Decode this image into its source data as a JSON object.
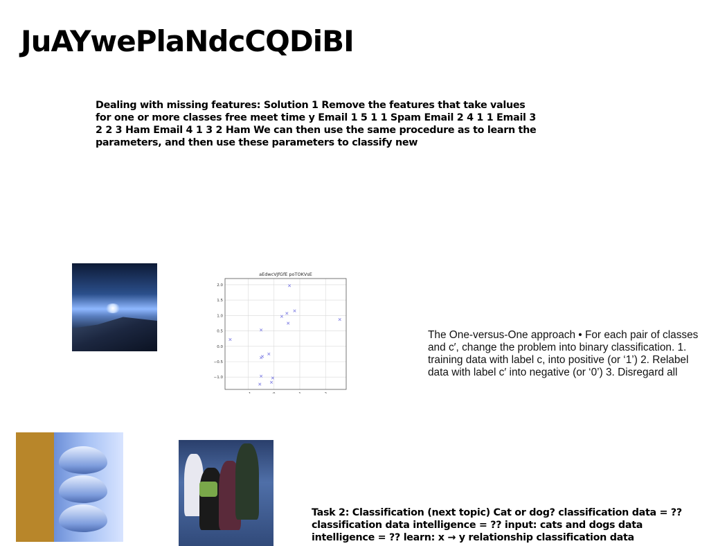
{
  "title": "JuAYwePlaNdcCQDiBI",
  "paragraphs": {
    "missing_features": "Dealing with missing features: Solution 1 Remove the features that take values for one or more classes free meet time y Email 1 5 1 1 Spam Email 2 4 1 1 Email 3 2 2 3 Ham Email 4 1 3 2 Ham We can then use the same procedure as to learn the parameters, and then use these parameters to classify new",
    "one_vs_one": "The One-versus-One approach • For each pair of classes and c′, change the problem into binary classification. 1. training data with label c, into positive (or ‘1’) 2. Relabel data with label c′ into negative (or ‘0’) 3. Disregard all",
    "task2": "Task 2: Classification (next topic) Cat or dog? classification data = ?? classification data intelligence = ?? input: cats and dogs data intelligence = ?? learn: x → y relationship classification data"
  },
  "chart_data": {
    "type": "scatter",
    "title": "aEdwcVJfGfE poTOKVsE",
    "xlabel": "",
    "ylabel": "",
    "xlim": [
      -1.9,
      2.8
    ],
    "ylim": [
      -1.4,
      2.2
    ],
    "grid": true,
    "xticks": [
      -1,
      0,
      1,
      2
    ],
    "yticks": [
      -1.0,
      -0.5,
      0.0,
      0.5,
      1.0,
      1.5,
      2.0
    ],
    "ytick_labels": [
      "−1.0",
      "−0.5",
      "0.0",
      "0.5",
      "1.0",
      "1.5",
      "2.0"
    ],
    "xtick_labels": [
      "−1",
      "0",
      "1",
      "2"
    ],
    "marker": "x",
    "color": "#8a8ae6",
    "points": [
      {
        "x": 0.6,
        "y": 1.97
      },
      {
        "x": 0.8,
        "y": 1.15
      },
      {
        "x": 0.5,
        "y": 1.07
      },
      {
        "x": 0.3,
        "y": 0.97
      },
      {
        "x": 0.55,
        "y": 0.75
      },
      {
        "x": 2.55,
        "y": 0.87
      },
      {
        "x": -1.7,
        "y": 0.22
      },
      {
        "x": -0.5,
        "y": 0.53
      },
      {
        "x": -0.2,
        "y": -0.25
      },
      {
        "x": -0.45,
        "y": -0.33
      },
      {
        "x": -0.5,
        "y": -0.37
      },
      {
        "x": -0.5,
        "y": -0.97
      },
      {
        "x": -0.05,
        "y": -1.03
      },
      {
        "x": -0.1,
        "y": -1.17
      },
      {
        "x": -0.55,
        "y": -1.23
      }
    ]
  }
}
